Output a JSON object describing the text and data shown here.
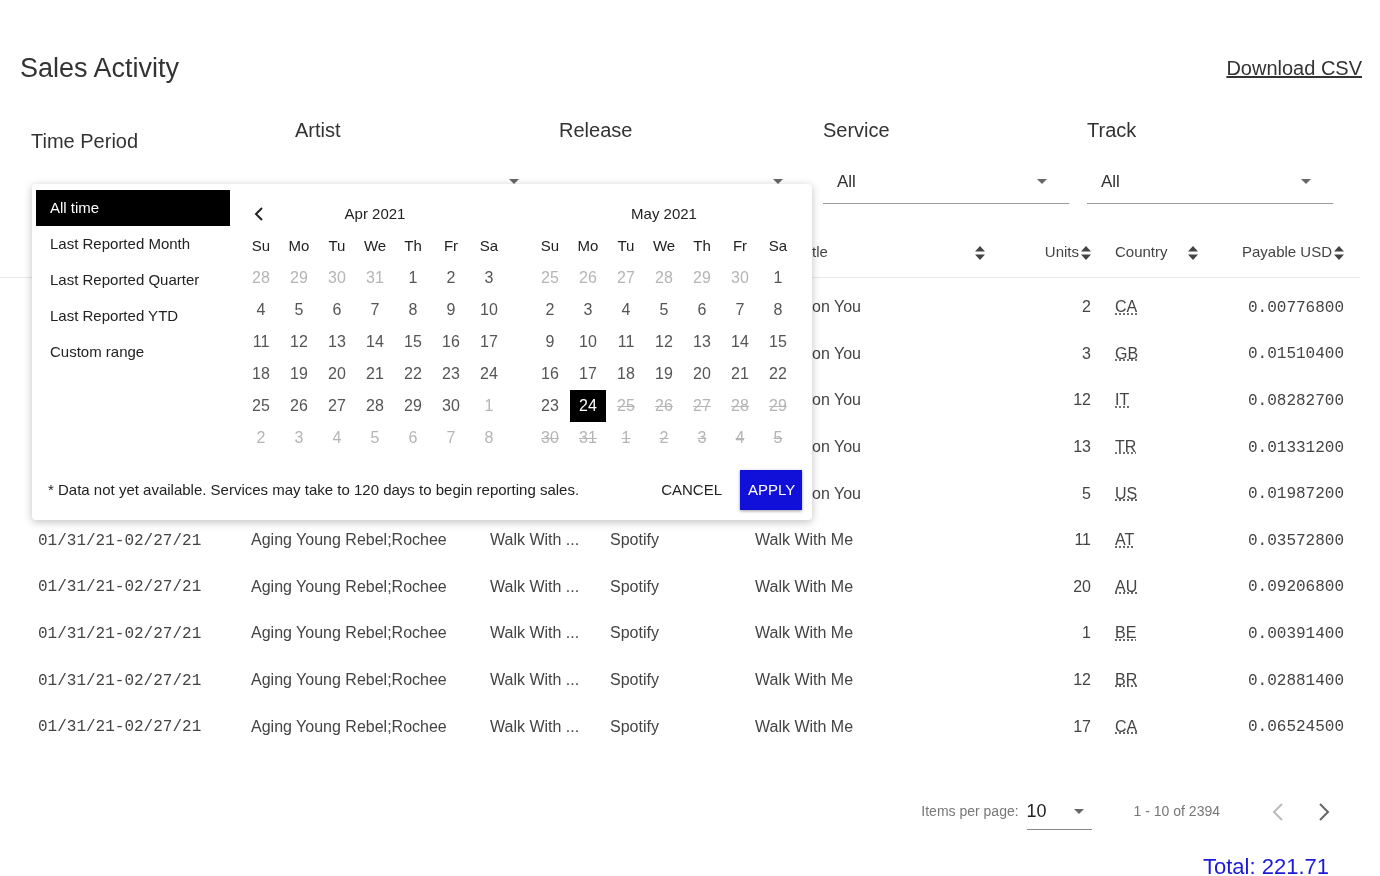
{
  "page": {
    "title": "Sales Activity",
    "download_link": "Download CSV"
  },
  "filters": [
    {
      "label": "Time Period",
      "kind": "period"
    },
    {
      "label": "Artist",
      "kind": "select"
    },
    {
      "label": "Release",
      "kind": "select"
    },
    {
      "label": "Service",
      "value": "All",
      "kind": "select"
    },
    {
      "label": "Track",
      "value": "All",
      "kind": "select"
    }
  ],
  "period_menu": [
    {
      "label": "All time",
      "selected": true
    },
    {
      "label": "Last Reported Month",
      "selected": false
    },
    {
      "label": "Last Reported Quarter",
      "selected": false
    },
    {
      "label": "Last Reported YTD",
      "selected": false
    },
    {
      "label": "Custom range",
      "selected": false
    }
  ],
  "calendars": [
    {
      "month": "Apr 2021",
      "weekdays": [
        "Su",
        "Mo",
        "Tu",
        "We",
        "Th",
        "Fr",
        "Sa"
      ],
      "weeks": [
        [
          {
            "label": "28",
            "kind": "outside",
            "selected": false
          },
          {
            "label": "29",
            "kind": "outside",
            "selected": false
          },
          {
            "label": "30",
            "kind": "outside",
            "selected": false
          },
          {
            "label": "31",
            "kind": "outside",
            "selected": false
          },
          {
            "label": "1",
            "kind": "day",
            "selected": false
          },
          {
            "label": "2",
            "kind": "day",
            "selected": false
          },
          {
            "label": "3",
            "kind": "day",
            "selected": false
          }
        ],
        [
          {
            "label": "4",
            "kind": "day",
            "selected": false
          },
          {
            "label": "5",
            "kind": "day",
            "selected": false
          },
          {
            "label": "6",
            "kind": "day",
            "selected": false
          },
          {
            "label": "7",
            "kind": "day",
            "selected": false
          },
          {
            "label": "8",
            "kind": "day",
            "selected": false
          },
          {
            "label": "9",
            "kind": "day",
            "selected": false
          },
          {
            "label": "10",
            "kind": "day",
            "selected": false
          }
        ],
        [
          {
            "label": "11",
            "kind": "day",
            "selected": false
          },
          {
            "label": "12",
            "kind": "day",
            "selected": false
          },
          {
            "label": "13",
            "kind": "day",
            "selected": false
          },
          {
            "label": "14",
            "kind": "day",
            "selected": false
          },
          {
            "label": "15",
            "kind": "day",
            "selected": false
          },
          {
            "label": "16",
            "kind": "day",
            "selected": false
          },
          {
            "label": "17",
            "kind": "day",
            "selected": false
          }
        ],
        [
          {
            "label": "18",
            "kind": "day",
            "selected": false
          },
          {
            "label": "19",
            "kind": "day",
            "selected": false
          },
          {
            "label": "20",
            "kind": "day",
            "selected": false
          },
          {
            "label": "21",
            "kind": "day",
            "selected": false
          },
          {
            "label": "22",
            "kind": "day",
            "selected": false
          },
          {
            "label": "23",
            "kind": "day",
            "selected": false
          },
          {
            "label": "24",
            "kind": "day",
            "selected": false
          }
        ],
        [
          {
            "label": "25",
            "kind": "day",
            "selected": false
          },
          {
            "label": "26",
            "kind": "day",
            "selected": false
          },
          {
            "label": "27",
            "kind": "day",
            "selected": false
          },
          {
            "label": "28",
            "kind": "day",
            "selected": false
          },
          {
            "label": "29",
            "kind": "day",
            "selected": false
          },
          {
            "label": "30",
            "kind": "day",
            "selected": false
          },
          {
            "label": "1",
            "kind": "outside",
            "selected": false
          }
        ],
        [
          {
            "label": "2",
            "kind": "outside",
            "selected": false
          },
          {
            "label": "3",
            "kind": "outside",
            "selected": false
          },
          {
            "label": "4",
            "kind": "outside",
            "selected": false
          },
          {
            "label": "5",
            "kind": "outside",
            "selected": false
          },
          {
            "label": "6",
            "kind": "outside",
            "selected": false
          },
          {
            "label": "7",
            "kind": "outside",
            "selected": false
          },
          {
            "label": "8",
            "kind": "outside",
            "selected": false
          }
        ]
      ]
    },
    {
      "month": "May 2021",
      "weekdays": [
        "Su",
        "Mo",
        "Tu",
        "We",
        "Th",
        "Fr",
        "Sa"
      ],
      "weeks": [
        [
          {
            "label": "25",
            "kind": "outside",
            "selected": false
          },
          {
            "label": "26",
            "kind": "outside",
            "selected": false
          },
          {
            "label": "27",
            "kind": "outside",
            "selected": false
          },
          {
            "label": "28",
            "kind": "outside",
            "selected": false
          },
          {
            "label": "29",
            "kind": "outside",
            "selected": false
          },
          {
            "label": "30",
            "kind": "outside",
            "selected": false
          },
          {
            "label": "1",
            "kind": "day",
            "selected": false
          }
        ],
        [
          {
            "label": "2",
            "kind": "day",
            "selected": false
          },
          {
            "label": "3",
            "kind": "day",
            "selected": false
          },
          {
            "label": "4",
            "kind": "day",
            "selected": false
          },
          {
            "label": "5",
            "kind": "day",
            "selected": false
          },
          {
            "label": "6",
            "kind": "day",
            "selected": false
          },
          {
            "label": "7",
            "kind": "day",
            "selected": false
          },
          {
            "label": "8",
            "kind": "day",
            "selected": false
          }
        ],
        [
          {
            "label": "9",
            "kind": "day",
            "selected": false
          },
          {
            "label": "10",
            "kind": "day",
            "selected": false
          },
          {
            "label": "11",
            "kind": "day",
            "selected": false
          },
          {
            "label": "12",
            "kind": "day",
            "selected": false
          },
          {
            "label": "13",
            "kind": "day",
            "selected": false
          },
          {
            "label": "14",
            "kind": "day",
            "selected": false
          },
          {
            "label": "15",
            "kind": "day",
            "selected": false
          }
        ],
        [
          {
            "label": "16",
            "kind": "day",
            "selected": false
          },
          {
            "label": "17",
            "kind": "day",
            "selected": false
          },
          {
            "label": "18",
            "kind": "day",
            "selected": false
          },
          {
            "label": "19",
            "kind": "day",
            "selected": false
          },
          {
            "label": "20",
            "kind": "day",
            "selected": false
          },
          {
            "label": "21",
            "kind": "day",
            "selected": false
          },
          {
            "label": "22",
            "kind": "day",
            "selected": false
          }
        ],
        [
          {
            "label": "23",
            "kind": "day",
            "selected": false
          },
          {
            "label": "24",
            "kind": "day",
            "selected": true
          },
          {
            "label": "25",
            "kind": "unavailable",
            "selected": false
          },
          {
            "label": "26",
            "kind": "unavailable",
            "selected": false
          },
          {
            "label": "27",
            "kind": "unavailable",
            "selected": false
          },
          {
            "label": "28",
            "kind": "unavailable",
            "selected": false
          },
          {
            "label": "29",
            "kind": "unavailable",
            "selected": false
          }
        ],
        [
          {
            "label": "30",
            "kind": "unavailable",
            "selected": false
          },
          {
            "label": "31",
            "kind": "unavailable",
            "selected": false
          },
          {
            "label": "1",
            "kind": "unavailable",
            "selected": false
          },
          {
            "label": "2",
            "kind": "unavailable",
            "selected": false
          },
          {
            "label": "3",
            "kind": "unavailable",
            "selected": false
          },
          {
            "label": "4",
            "kind": "unavailable",
            "selected": false
          },
          {
            "label": "5",
            "kind": "unavailable",
            "selected": false
          }
        ]
      ]
    }
  ],
  "picker_note": "* Data not yet available. Services may take to 120 days to begin reporting sales.",
  "picker_buttons": {
    "cancel": "CANCEL",
    "apply": "APPLY"
  },
  "table": {
    "columns": [
      {
        "label": "tle"
      },
      {
        "label": "Units"
      },
      {
        "label": "Country"
      },
      {
        "label": "Payable USD"
      }
    ],
    "rows": [
      {
        "track": "on You",
        "units": "2",
        "country": "CA",
        "payable": "0.00776800"
      },
      {
        "track": "on You",
        "units": "3",
        "country": "GB",
        "payable": "0.01510400"
      },
      {
        "track": "on You",
        "units": "12",
        "country": "IT",
        "payable": "0.08282700"
      },
      {
        "track": "on You",
        "units": "13",
        "country": "TR",
        "payable": "0.01331200"
      },
      {
        "track": "on You",
        "units": "5",
        "country": "US",
        "payable": "0.01987200"
      },
      {
        "period": "01/31/21-02/27/21",
        "artist": "Aging Young Rebel;Rochee",
        "release": "Walk With ...",
        "service": "Spotify",
        "track": "Walk With Me",
        "units": "11",
        "country": "AT",
        "payable": "0.03572800"
      },
      {
        "period": "01/31/21-02/27/21",
        "artist": "Aging Young Rebel;Rochee",
        "release": "Walk With ...",
        "service": "Spotify",
        "track": "Walk With Me",
        "units": "20",
        "country": "AU",
        "payable": "0.09206800"
      },
      {
        "period": "01/31/21-02/27/21",
        "artist": "Aging Young Rebel;Rochee",
        "release": "Walk With ...",
        "service": "Spotify",
        "track": "Walk With Me",
        "units": "1",
        "country": "BE",
        "payable": "0.00391400"
      },
      {
        "period": "01/31/21-02/27/21",
        "artist": "Aging Young Rebel;Rochee",
        "release": "Walk With ...",
        "service": "Spotify",
        "track": "Walk With Me",
        "units": "12",
        "country": "BR",
        "payable": "0.02881400"
      },
      {
        "period": "01/31/21-02/27/21",
        "artist": "Aging Young Rebel;Rochee",
        "release": "Walk With ...",
        "service": "Spotify",
        "track": "Walk With Me",
        "units": "17",
        "country": "CA",
        "payable": "0.06524500"
      }
    ]
  },
  "pagination": {
    "label": "Items per page:",
    "page_size": "10",
    "range": "1 - 10 of 2394"
  },
  "total": "Total: 221.71"
}
